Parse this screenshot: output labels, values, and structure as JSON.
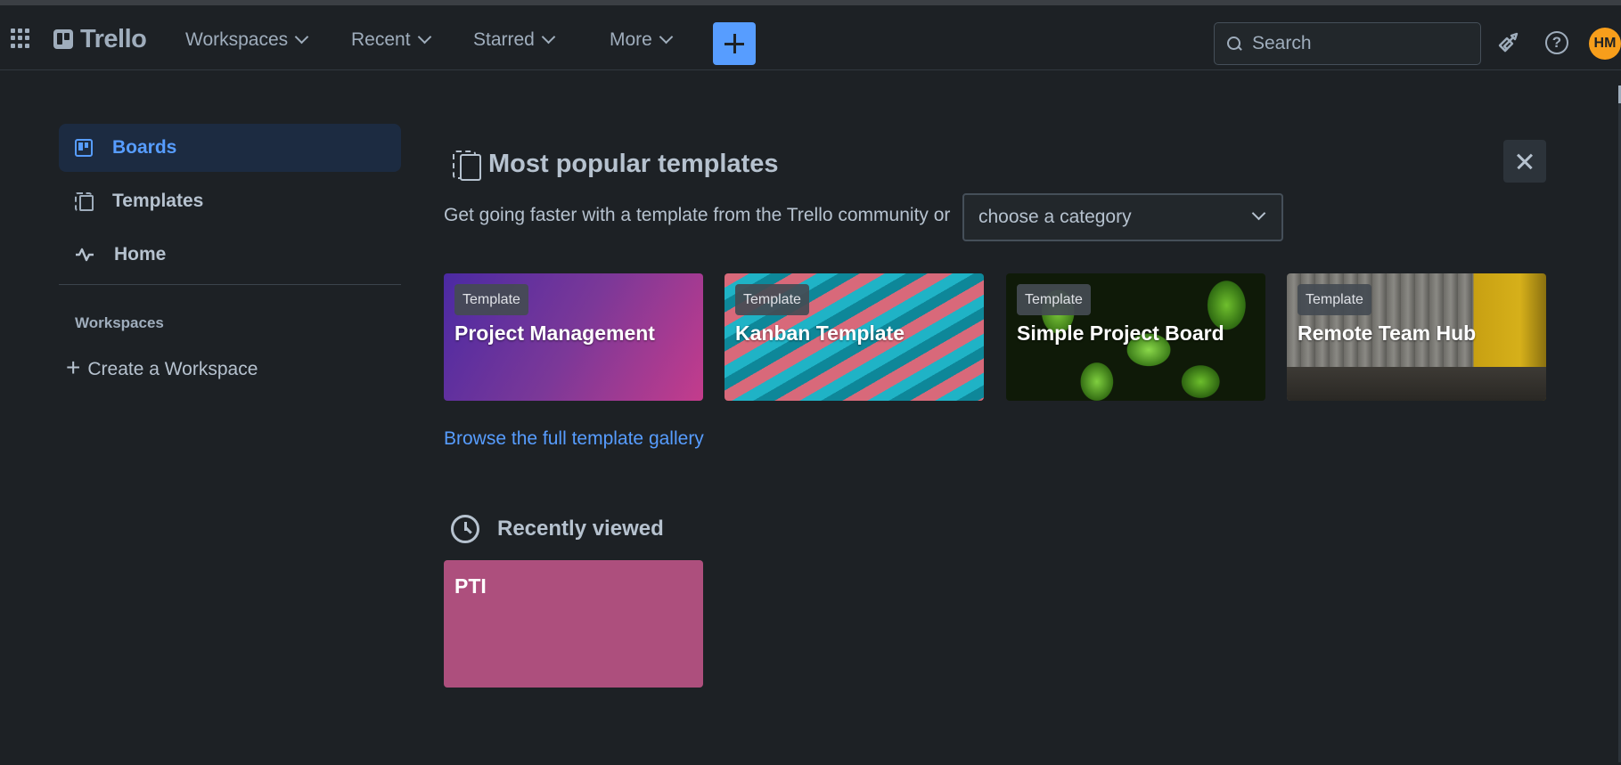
{
  "header": {
    "logo_text": "Trello",
    "nav": [
      {
        "label": "Workspaces"
      },
      {
        "label": "Recent"
      },
      {
        "label": "Starred"
      },
      {
        "label": "More"
      }
    ],
    "search_placeholder": "Search",
    "avatar_initials": "HM",
    "help_glyph": "?"
  },
  "sidebar": {
    "items": [
      {
        "label": "Boards",
        "icon": "board-icon",
        "active": true
      },
      {
        "label": "Templates",
        "icon": "template-icon",
        "active": false
      },
      {
        "label": "Home",
        "icon": "activity-icon",
        "active": false
      }
    ],
    "workspaces_heading": "Workspaces",
    "create_workspace_label": "Create a Workspace",
    "create_workspace_glyph": "+"
  },
  "main": {
    "templates_title": "Most popular templates",
    "subtitle": "Get going faster with a template from the Trello community or",
    "category_select": {
      "value": "choose a category"
    },
    "template_badge": "Template",
    "templates": [
      {
        "title": "Project Management"
      },
      {
        "title": "Kanban Template"
      },
      {
        "title": "Simple Project Board"
      },
      {
        "title": "Remote Team Hub"
      }
    ],
    "gallery_link": "Browse the full template gallery",
    "recently_viewed_title": "Recently viewed",
    "recent_boards": [
      {
        "title": "PTI",
        "color": "#ad4f7d"
      }
    ]
  },
  "colors": {
    "background": "#1d2125",
    "accent": "#579dff",
    "avatar": "#f79e1b",
    "active_item_bg": "#1c2b41"
  }
}
